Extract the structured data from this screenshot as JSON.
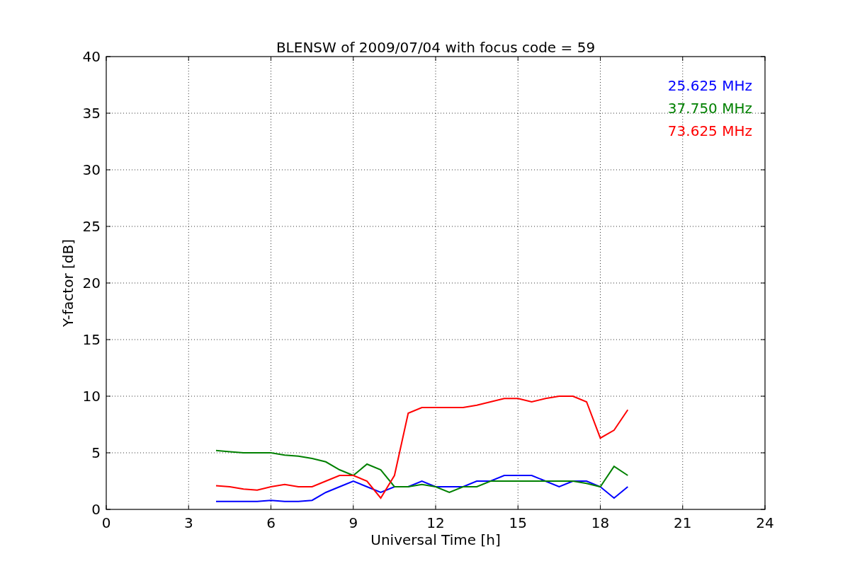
{
  "chart_data": {
    "type": "line",
    "title": "BLENSW of 2009/07/04 with focus code = 59",
    "xlabel": "Universal Time [h]",
    "ylabel": "Y-factor [dB]",
    "x": [
      4,
      4.5,
      5,
      5.5,
      6,
      6.5,
      7,
      7.5,
      8,
      8.5,
      9,
      9.5,
      10,
      10.5,
      11,
      11.5,
      12,
      12.5,
      13,
      13.5,
      14,
      14.5,
      15,
      15.5,
      16,
      16.5,
      17,
      17.5,
      18,
      18.5,
      19
    ],
    "series": [
      {
        "name": "25.625 MHz",
        "color": "#0000ff",
        "values": [
          0.7,
          0.7,
          0.7,
          0.7,
          0.8,
          0.7,
          0.7,
          0.8,
          1.5,
          2,
          2.5,
          2,
          1.5,
          2,
          2,
          2.5,
          2,
          2,
          2,
          2.5,
          2.5,
          3,
          3,
          3,
          2.5,
          2,
          2.5,
          2.5,
          2,
          1,
          2
        ]
      },
      {
        "name": "37.750 MHz",
        "color": "#008000",
        "values": [
          5.2,
          5.1,
          5,
          5,
          5,
          4.8,
          4.7,
          4.5,
          4.2,
          3.5,
          3,
          4,
          3.5,
          2,
          2,
          2.2,
          2,
          1.5,
          2,
          2,
          2.5,
          2.5,
          2.5,
          2.5,
          2.5,
          2.5,
          2.5,
          2.3,
          2,
          3.8,
          3
        ]
      },
      {
        "name": "73.625 MHz",
        "color": "#ff0000",
        "values": [
          2.1,
          2,
          1.8,
          1.7,
          2,
          2.2,
          2,
          2,
          2.5,
          3,
          3,
          2.5,
          1,
          3,
          8.5,
          9,
          9,
          9,
          9,
          9.2,
          9.5,
          9.8,
          9.8,
          9.5,
          9.8,
          10,
          10,
          9.5,
          6.3,
          7,
          8.8
        ]
      }
    ],
    "xlim": [
      0,
      24
    ],
    "ylim": [
      0,
      40
    ],
    "xticks": [
      0,
      3,
      6,
      9,
      12,
      15,
      18,
      21,
      24
    ],
    "yticks": [
      0,
      5,
      10,
      15,
      20,
      25,
      30,
      35,
      40
    ],
    "grid": true
  }
}
